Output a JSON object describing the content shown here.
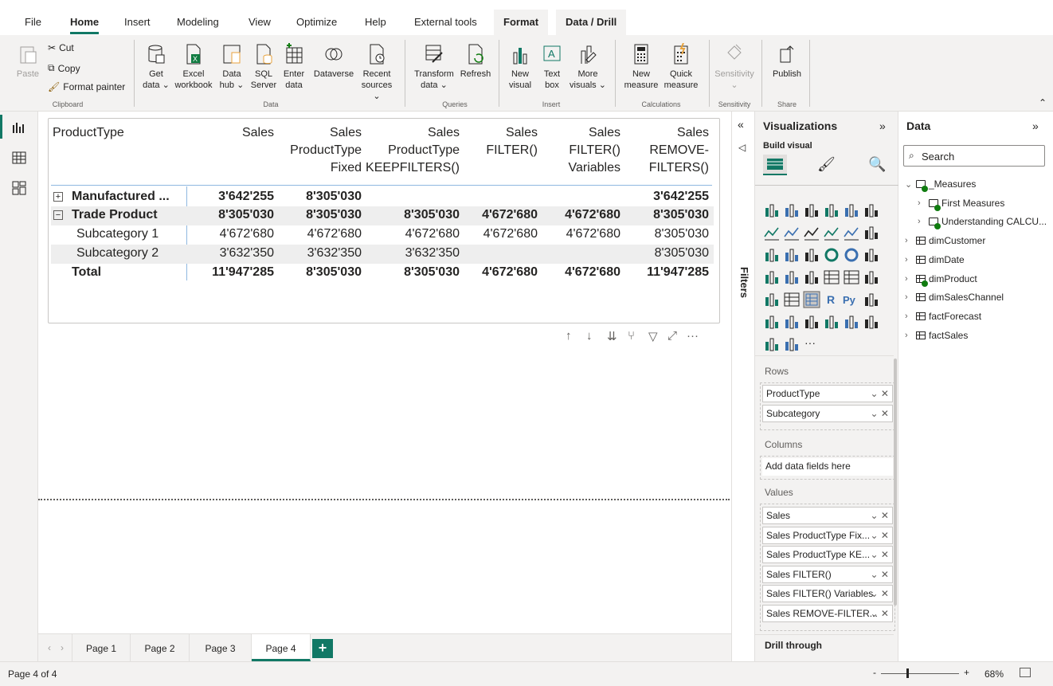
{
  "menu": {
    "items": [
      "File",
      "Home",
      "Insert",
      "Modeling",
      "View",
      "Optimize",
      "Help",
      "External tools"
    ],
    "active": "Home",
    "context_tabs": [
      "Format",
      "Data / Drill"
    ]
  },
  "ribbon": {
    "clipboard": {
      "paste": "Paste",
      "cut": "Cut",
      "copy": "Copy",
      "format_painter": "Format painter",
      "label": "Clipboard"
    },
    "data": {
      "get_data": [
        "Get",
        "data"
      ],
      "excel": [
        "Excel",
        "workbook"
      ],
      "data_hub": [
        "Data",
        "hub"
      ],
      "sql": [
        "SQL",
        "Server"
      ],
      "enter": [
        "Enter",
        "data"
      ],
      "dataverse": "Dataverse",
      "recent": [
        "Recent",
        "sources"
      ],
      "label": "Data"
    },
    "queries": {
      "transform": [
        "Transform",
        "data"
      ],
      "refresh": "Refresh",
      "label": "Queries"
    },
    "insert": {
      "new_visual": [
        "New",
        "visual"
      ],
      "text_box": [
        "Text",
        "box"
      ],
      "more_visuals": [
        "More",
        "visuals"
      ],
      "label": "Insert"
    },
    "calculations": {
      "new_measure": [
        "New",
        "measure"
      ],
      "quick_measure": [
        "Quick",
        "measure"
      ],
      "label": "Calculations"
    },
    "sensitivity": {
      "button": "Sensitivity",
      "label": "Sensitivity"
    },
    "share": {
      "publish": "Publish",
      "label": "Share"
    }
  },
  "matrix": {
    "headers": [
      [
        "ProductType"
      ],
      [
        "Sales"
      ],
      [
        "Sales",
        "ProductType",
        "Fixed"
      ],
      [
        "Sales",
        "ProductType",
        "KEEPFILTERS()"
      ],
      [
        "Sales",
        "FILTER()"
      ],
      [
        "Sales",
        "FILTER()",
        "Variables"
      ],
      [
        "Sales",
        "REMOVE-",
        "FILTERS()"
      ]
    ],
    "rows": [
      {
        "label": "Manufactured ...",
        "toggle": "+",
        "bold": true,
        "values": [
          "3'642'255",
          "8'305'030",
          "",
          "",
          "",
          "3'642'255"
        ]
      },
      {
        "label": "Trade Product",
        "toggle": "−",
        "bold": true,
        "values": [
          "8'305'030",
          "8'305'030",
          "8'305'030",
          "4'672'680",
          "4'672'680",
          "8'305'030"
        ]
      },
      {
        "label": "Subcategory 1",
        "toggle": "",
        "bold": false,
        "values": [
          "4'672'680",
          "4'672'680",
          "4'672'680",
          "4'672'680",
          "4'672'680",
          "8'305'030"
        ]
      },
      {
        "label": "Subcategory 2",
        "toggle": "",
        "bold": false,
        "values": [
          "3'632'350",
          "3'632'350",
          "3'632'350",
          "",
          "",
          "8'305'030"
        ]
      },
      {
        "label": "Total",
        "toggle": "",
        "bold": true,
        "values": [
          "11'947'285",
          "8'305'030",
          "8'305'030",
          "4'672'680",
          "4'672'680",
          "11'947'285"
        ]
      }
    ]
  },
  "pages": {
    "tabs": [
      "Page 1",
      "Page 2",
      "Page 3",
      "Page 4"
    ],
    "active": "Page 4",
    "add": "+"
  },
  "status": {
    "page": "Page 4 of 4",
    "zoom": "68%"
  },
  "filters": {
    "label": "Filters"
  },
  "visualizations": {
    "title": "Visualizations",
    "build_visual": "Build visual",
    "rows_label": "Rows",
    "rows": [
      "ProductType",
      "Subcategory"
    ],
    "columns_label": "Columns",
    "columns_placeholder": "Add data fields here",
    "values_label": "Values",
    "values": [
      "Sales",
      "Sales ProductType Fix...",
      "Sales ProductType KE...",
      "Sales FILTER()",
      "Sales FILTER() Variables",
      "Sales REMOVE-FILTER..."
    ],
    "drill_through": "Drill through",
    "viz_icons": [
      "stacked-bar-icon",
      "stacked-column-icon",
      "clustered-bar-icon",
      "clustered-column-icon",
      "100-bar-icon",
      "100-column-icon",
      "line-icon",
      "area-icon",
      "stacked-area-icon",
      "line-column-icon",
      "line-clustered-icon",
      "ribbon-icon",
      "waterfall-icon",
      "funnel-icon",
      "scatter-icon",
      "pie-icon",
      "donut-icon",
      "treemap-icon",
      "map-icon",
      "filled-map-icon",
      "gauge-icon",
      "card-icon",
      "multirow-card-icon",
      "kpi-icon",
      "slicer-icon",
      "table-icon",
      "matrix-icon",
      "r-visual-icon",
      "python-visual-icon",
      "key-influencers-icon",
      "decomposition-tree-icon",
      "qa-icon",
      "smart-narrative-icon",
      "goals-icon",
      "paginated-icon",
      "azure-map-icon",
      "power-apps-icon",
      "power-automate-icon",
      "more-icon"
    ]
  },
  "data_pane": {
    "title": "Data",
    "search_placeholder": "Search",
    "items": [
      {
        "name": "_Measures",
        "level": 0,
        "expanded": true,
        "kind": "measures"
      },
      {
        "name": "First Measures",
        "level": 1,
        "expanded": false,
        "kind": "folder"
      },
      {
        "name": "Understanding CALCU...",
        "level": 1,
        "expanded": false,
        "kind": "folder"
      },
      {
        "name": "dimCustomer",
        "level": 0,
        "expanded": false,
        "kind": "table"
      },
      {
        "name": "dimDate",
        "level": 0,
        "expanded": false,
        "kind": "table"
      },
      {
        "name": "dimProduct",
        "level": 0,
        "expanded": false,
        "kind": "table-check"
      },
      {
        "name": "dimSalesChannel",
        "level": 0,
        "expanded": false,
        "kind": "table"
      },
      {
        "name": "factForecast",
        "level": 0,
        "expanded": false,
        "kind": "table"
      },
      {
        "name": "factSales",
        "level": 0,
        "expanded": false,
        "kind": "table"
      }
    ]
  },
  "colors": {
    "accent": "#117865",
    "pane_bg": "#f3f2f1",
    "check_green": "#107c10"
  }
}
